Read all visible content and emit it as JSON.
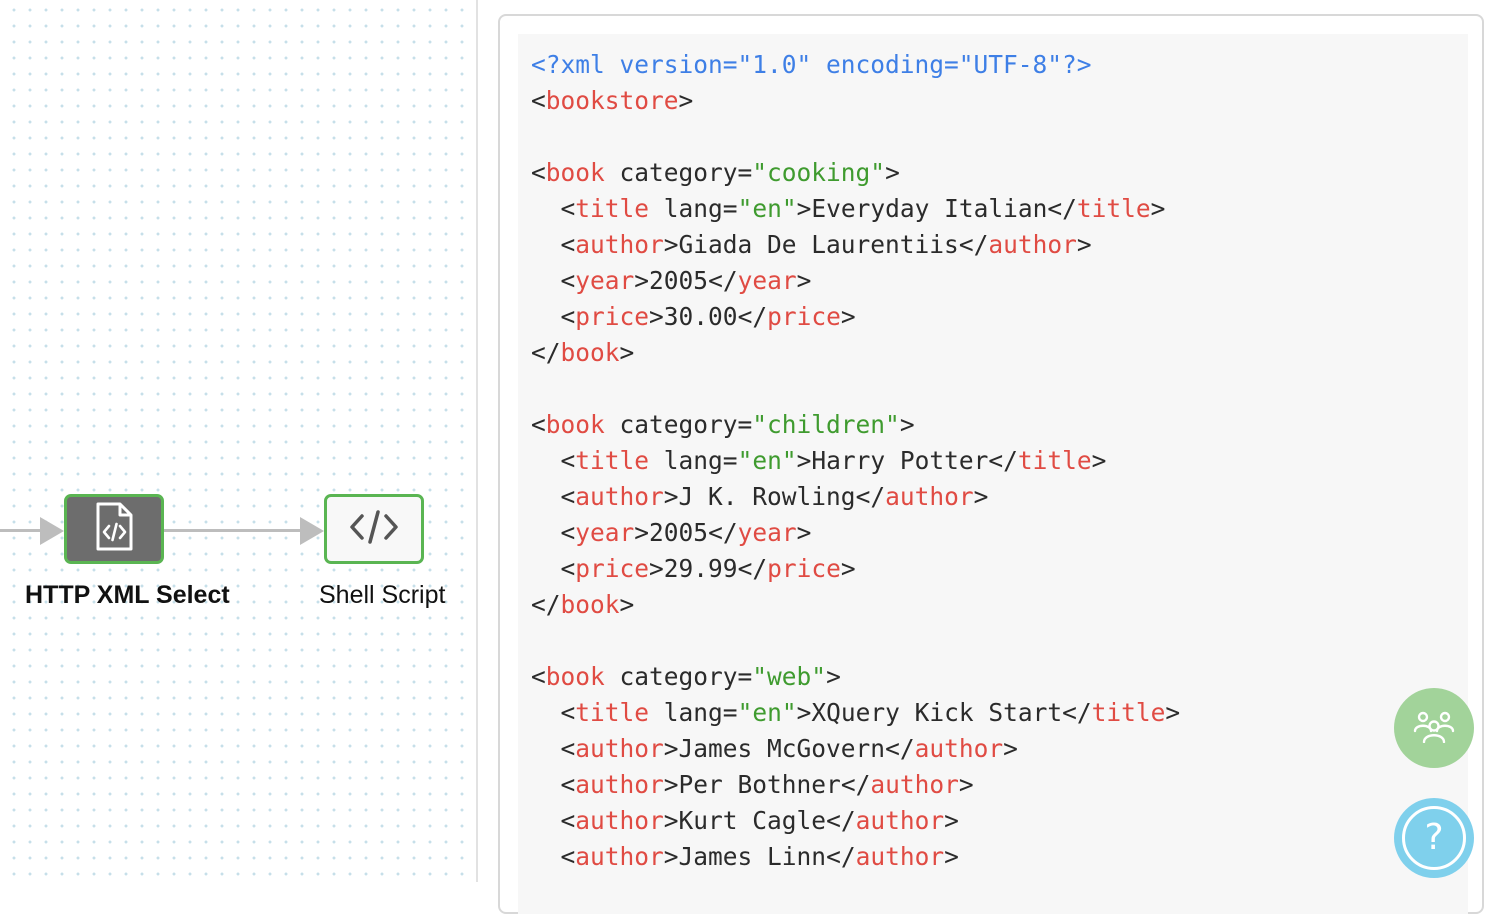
{
  "flow": {
    "nodes": [
      {
        "label": "HTTP XML Select",
        "icon": "xml-file-icon",
        "selected": true
      },
      {
        "label": "Shell Script",
        "icon": "code-icon",
        "selected": false
      }
    ]
  },
  "code_panel": {
    "lines": [
      "<?xml version=\"1.0\" encoding=\"UTF-8\"?>",
      "<bookstore>",
      "",
      "<book category=\"cooking\">",
      "  <title lang=\"en\">Everyday Italian</title>",
      "  <author>Giada De Laurentiis</author>",
      "  <year>2005</year>",
      "  <price>30.00</price>",
      "</book>",
      "",
      "<book category=\"children\">",
      "  <title lang=\"en\">Harry Potter</title>",
      "  <author>J K. Rowling</author>",
      "  <year>2005</year>",
      "  <price>29.99</price>",
      "</book>",
      "",
      "<book category=\"web\">",
      "  <title lang=\"en\">XQuery Kick Start</title>",
      "  <author>James McGovern</author>",
      "  <author>Per Bothner</author>",
      "  <author>Kurt Cagle</author>",
      "  <author>James Linn</author>"
    ]
  },
  "floating_buttons": {
    "community_icon": "community-icon",
    "help_symbol": "?"
  },
  "colors": {
    "node_border": "#5ab552",
    "xml_declaration": "#3e7fe6",
    "xml_tag": "#e04b43",
    "xml_string": "#3f9b2f"
  }
}
